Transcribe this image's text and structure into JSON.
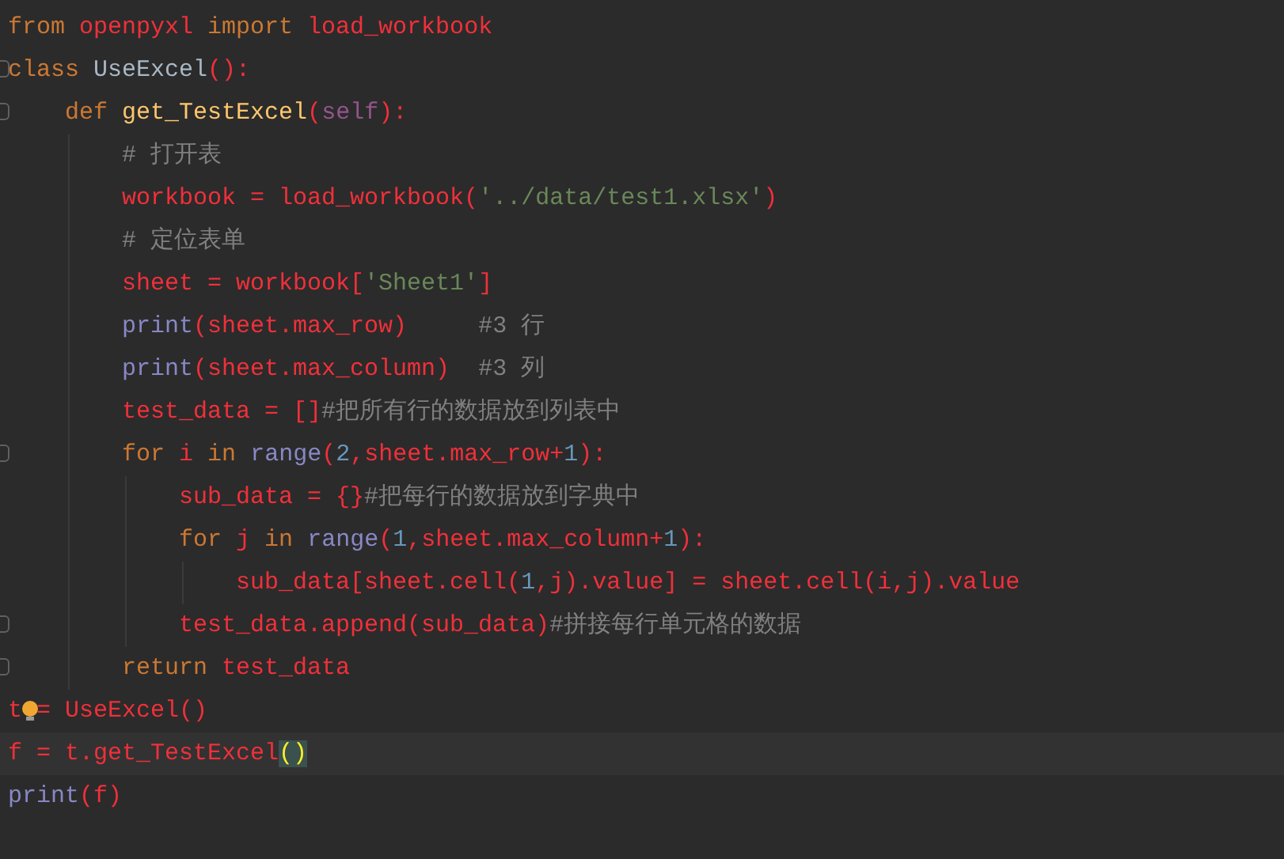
{
  "editor": {
    "lines": [
      {
        "current": false,
        "fold": false,
        "tokens": [
          {
            "kind": "keyword",
            "text": "from "
          },
          {
            "kind": "name",
            "text": "openpyxl "
          },
          {
            "kind": "keyword",
            "text": "import "
          },
          {
            "kind": "name",
            "text": "load_workbook"
          }
        ]
      },
      {
        "current": false,
        "fold": true,
        "tokens": [
          {
            "kind": "keyword",
            "text": "class "
          },
          {
            "kind": "classname",
            "text": "UseExcel"
          },
          {
            "kind": "name",
            "text": "():"
          }
        ]
      },
      {
        "current": false,
        "fold": true,
        "tokens": [
          {
            "kind": "keyword",
            "text": "    def "
          },
          {
            "kind": "funcname",
            "text": "get_TestExcel"
          },
          {
            "kind": "name",
            "text": "("
          },
          {
            "kind": "self",
            "text": "self"
          },
          {
            "kind": "name",
            "text": "):"
          }
        ]
      },
      {
        "current": false,
        "fold": false,
        "tokens": [
          {
            "kind": "comment",
            "text": "        # 打开表"
          }
        ]
      },
      {
        "current": false,
        "fold": false,
        "tokens": [
          {
            "kind": "name",
            "text": "        workbook = load_workbook("
          },
          {
            "kind": "string",
            "text": "'../data/test1.xlsx'"
          },
          {
            "kind": "name",
            "text": ")"
          }
        ]
      },
      {
        "current": false,
        "fold": false,
        "tokens": [
          {
            "kind": "comment",
            "text": "        # 定位表单"
          }
        ]
      },
      {
        "current": false,
        "fold": false,
        "tokens": [
          {
            "kind": "name",
            "text": "        sheet = workbook["
          },
          {
            "kind": "string",
            "text": "'Sheet1'"
          },
          {
            "kind": "name",
            "text": "]"
          }
        ]
      },
      {
        "current": false,
        "fold": false,
        "tokens": [
          {
            "kind": "builtin",
            "text": "        print"
          },
          {
            "kind": "name",
            "text": "(sheet.max_row)     "
          },
          {
            "kind": "comment",
            "text": "#3 行"
          }
        ]
      },
      {
        "current": false,
        "fold": false,
        "tokens": [
          {
            "kind": "builtin",
            "text": "        print"
          },
          {
            "kind": "name",
            "text": "(sheet.max_column)  "
          },
          {
            "kind": "comment",
            "text": "#3 列"
          }
        ]
      },
      {
        "current": false,
        "fold": false,
        "tokens": [
          {
            "kind": "name",
            "text": "        test_data = []"
          },
          {
            "kind": "comment",
            "text": "#把所有行的数据放到列表中"
          }
        ]
      },
      {
        "current": false,
        "fold": true,
        "tokens": [
          {
            "kind": "keyword",
            "text": "        for "
          },
          {
            "kind": "name",
            "text": "i "
          },
          {
            "kind": "keyword",
            "text": "in "
          },
          {
            "kind": "builtin",
            "text": "range"
          },
          {
            "kind": "name",
            "text": "("
          },
          {
            "kind": "number",
            "text": "2"
          },
          {
            "kind": "name",
            "text": ",sheet.max_row+"
          },
          {
            "kind": "number",
            "text": "1"
          },
          {
            "kind": "name",
            "text": "):"
          }
        ]
      },
      {
        "current": false,
        "fold": false,
        "tokens": [
          {
            "kind": "name",
            "text": "            sub_data = {}"
          },
          {
            "kind": "comment",
            "text": "#把每行的数据放到字典中"
          }
        ]
      },
      {
        "current": false,
        "fold": false,
        "tokens": [
          {
            "kind": "keyword",
            "text": "            for "
          },
          {
            "kind": "name",
            "text": "j "
          },
          {
            "kind": "keyword",
            "text": "in "
          },
          {
            "kind": "builtin",
            "text": "range"
          },
          {
            "kind": "name",
            "text": "("
          },
          {
            "kind": "number",
            "text": "1"
          },
          {
            "kind": "name",
            "text": ",sheet.max_column+"
          },
          {
            "kind": "number",
            "text": "1"
          },
          {
            "kind": "name",
            "text": "):"
          }
        ]
      },
      {
        "current": false,
        "fold": false,
        "tokens": [
          {
            "kind": "name",
            "text": "                sub_data[sheet.cell("
          },
          {
            "kind": "number",
            "text": "1"
          },
          {
            "kind": "name",
            "text": ",j).value] = sheet.cell(i,j).value"
          }
        ]
      },
      {
        "current": false,
        "fold": true,
        "tokens": [
          {
            "kind": "name",
            "text": "            test_data.append(sub_data)"
          },
          {
            "kind": "comment",
            "text": "#拼接每行单元格的数据"
          }
        ]
      },
      {
        "current": false,
        "fold": true,
        "tokens": [
          {
            "kind": "keyword",
            "text": "        return "
          },
          {
            "kind": "name",
            "text": "test_data"
          }
        ]
      },
      {
        "current": false,
        "fold": false,
        "tokens": [
          {
            "kind": "name",
            "text": "t"
          },
          {
            "kind": "bulb"
          },
          {
            "kind": "name",
            "text": "= UseExcel()"
          }
        ]
      },
      {
        "current": true,
        "fold": false,
        "tokens": [
          {
            "kind": "name",
            "text": "f = t.get_TestExcel"
          },
          {
            "kind": "bracket",
            "text": "()"
          }
        ]
      },
      {
        "current": false,
        "fold": false,
        "tokens": [
          {
            "kind": "builtin",
            "text": "print"
          },
          {
            "kind": "name",
            "text": "(f)"
          }
        ]
      }
    ]
  }
}
